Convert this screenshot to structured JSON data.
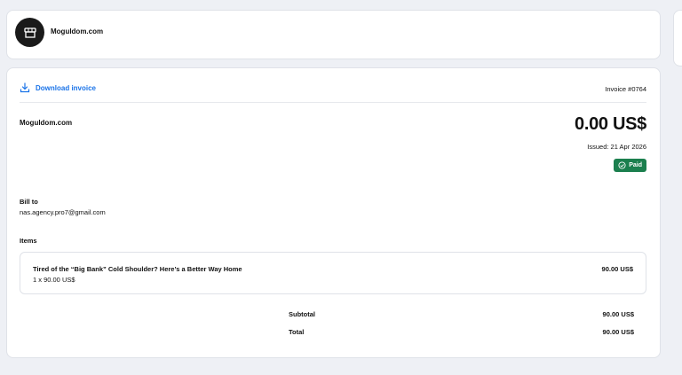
{
  "header": {
    "store_name": "Moguldom.com",
    "logo_icon": "store-icon"
  },
  "invoice": {
    "download_label": "Download invoice",
    "download_icon": "download-icon",
    "number": "Invoice #0764",
    "seller": "Moguldom.com",
    "amount": "0.00 US$",
    "issued": "Issued: 21 Apr 2026",
    "status": "Paid",
    "status_icon": "check-circle-icon",
    "status_color": "#1b7f4e",
    "link_color": "#1a73e8"
  },
  "bill_to": {
    "label": "Bill to",
    "email": "nas.agency.pro7@gmail.com"
  },
  "items": {
    "label": "Items",
    "list": [
      {
        "title": "Tired of the “Big Bank” Cold Shoulder? Here’s a Better Way Home",
        "qty_price": "1 x 90.00 US$",
        "price": "90.00 US$"
      }
    ]
  },
  "summary": {
    "subtotal_label": "Subtotal",
    "subtotal_value": "90.00 US$",
    "total_label": "Total",
    "total_value": "90.00 US$"
  }
}
